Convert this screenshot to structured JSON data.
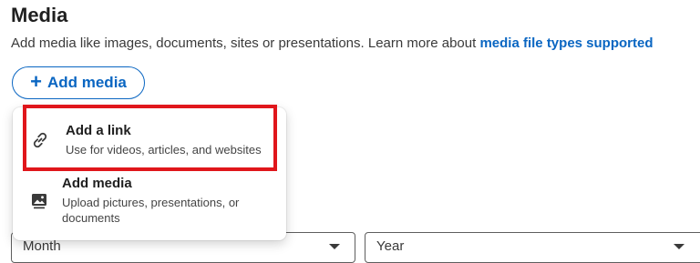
{
  "section": {
    "title": "Media",
    "description": "Add media like images, documents, sites or presentations. Learn more about ",
    "link_text": "media file types supported"
  },
  "add_media_button": {
    "label": "Add media",
    "icon": "plus-icon",
    "color": "#0a66c2"
  },
  "dropdown": {
    "items": [
      {
        "icon": "link-icon",
        "title": "Add a link",
        "description": "Use for videos, articles, and websites"
      },
      {
        "icon": "image-icon",
        "title": "Add media",
        "description": "Upload pictures, presentations, or documents"
      }
    ]
  },
  "form": {
    "month_placeholder": "Month",
    "year_placeholder": "Year"
  },
  "annotation": {
    "highlight_color": "#e0161b"
  }
}
